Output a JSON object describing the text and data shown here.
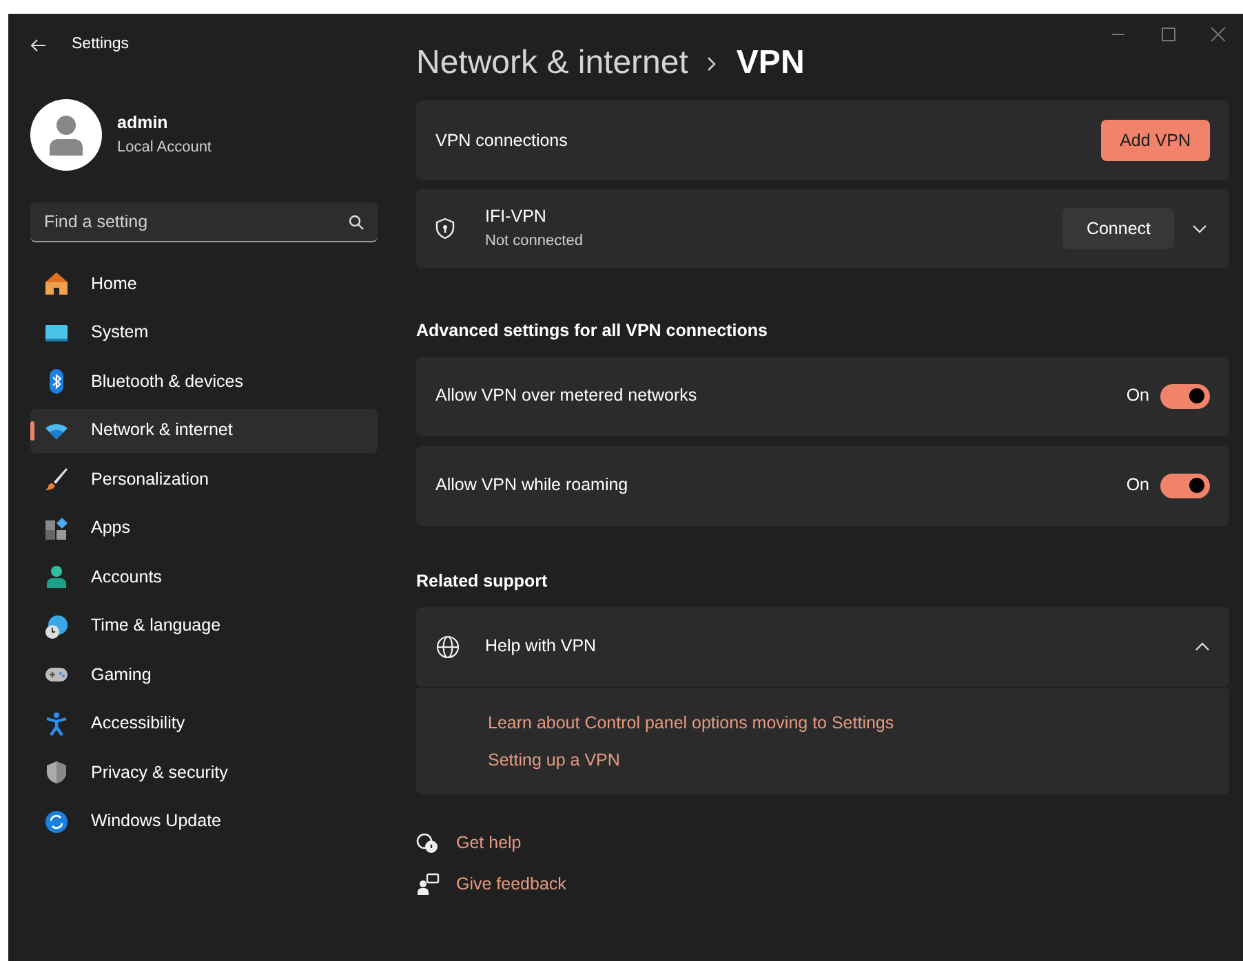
{
  "window": {
    "title": "Settings"
  },
  "account": {
    "name": "admin",
    "type": "Local Account"
  },
  "search": {
    "placeholder": "Find a setting"
  },
  "sidebar": {
    "items": [
      {
        "label": "Home",
        "selected": false
      },
      {
        "label": "System",
        "selected": false
      },
      {
        "label": "Bluetooth & devices",
        "selected": false
      },
      {
        "label": "Network & internet",
        "selected": true
      },
      {
        "label": "Personalization",
        "selected": false
      },
      {
        "label": "Apps",
        "selected": false
      },
      {
        "label": "Accounts",
        "selected": false
      },
      {
        "label": "Time & language",
        "selected": false
      },
      {
        "label": "Gaming",
        "selected": false
      },
      {
        "label": "Accessibility",
        "selected": false
      },
      {
        "label": "Privacy & security",
        "selected": false
      },
      {
        "label": "Windows Update",
        "selected": false
      }
    ]
  },
  "breadcrumb": [
    "Network & internet",
    "VPN"
  ],
  "vpn_connections": {
    "label": "VPN connections",
    "button": "Add VPN"
  },
  "connections": [
    {
      "name": "IFI-VPN",
      "status": "Not connected",
      "button": "Connect",
      "expanded": false
    }
  ],
  "advanced": {
    "heading": "Advanced settings for all VPN connections",
    "settings": [
      {
        "label": "Allow VPN over metered networks",
        "state_text": "On",
        "on": true
      },
      {
        "label": "Allow VPN while roaming",
        "state_text": "On",
        "on": true
      }
    ]
  },
  "related": {
    "heading": "Related support",
    "title": "Help with VPN",
    "expanded": true,
    "links": [
      "Learn about Control panel options moving to Settings",
      "Setting up a VPN"
    ]
  },
  "footer_links": [
    "Get help",
    "Give feedback"
  ]
}
